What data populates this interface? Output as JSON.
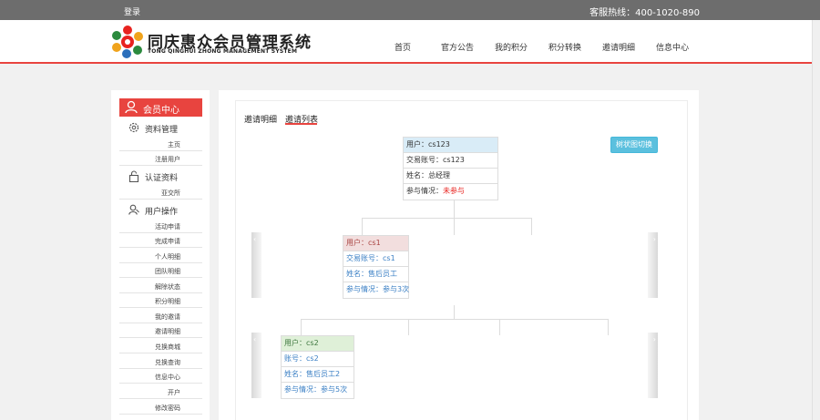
{
  "topbar": {
    "login": "登录",
    "hotline": "客服热线：400-1020-890"
  },
  "brand": {
    "title": "同庆惠众会员管理系统",
    "subtitle": "TONG QINGHUI ZHONG MANAGEMENT SYSTEM"
  },
  "nav": [
    "首页",
    "官方公告",
    "我的积分",
    "积分转换",
    "邀请明细",
    "信息中心"
  ],
  "sidebar": {
    "header": "会员中心",
    "sections": [
      {
        "title": "资料管理",
        "icon": "gear-icon",
        "items": [
          "主页",
          "注册用户"
        ]
      },
      {
        "title": "认证资料",
        "icon": "lock-icon",
        "items": [
          "亚交所"
        ]
      },
      {
        "title": "用户操作",
        "icon": "user-icon",
        "items": [
          "活动申请",
          "完成申请",
          "个人明细",
          "团队明细",
          "解除状态",
          "积分明细",
          "我的邀请",
          "邀请明细",
          "兑换商城",
          "兑换查询",
          "信息中心",
          "开户",
          "修改密码"
        ]
      }
    ]
  },
  "tabs": [
    "邀请明细",
    "邀请列表"
  ],
  "switch_button": "树状图切换",
  "tree": {
    "root": {
      "user": "用户：cs123",
      "account": "交易账号：cs123",
      "name": "姓名：总经理",
      "participation_label": "参与情况：",
      "participation_value": "未参与"
    },
    "level2": {
      "user": "用户：cs1",
      "account": "交易账号：cs1",
      "name": "姓名：售后员工",
      "participation": "参与情况：参与3次"
    },
    "level3": {
      "user": "用户：cs2",
      "account": "账号：cs2",
      "name": "姓名：售后员工2",
      "participation": "参与情况：参与5次"
    }
  },
  "colors": {
    "accent": "#e8443f",
    "topbar": "#6d6d6d",
    "button": "#5bc0de",
    "root_header": "#d9ecf7",
    "l2_header": "#f2dede",
    "l3_header": "#dff0d8"
  }
}
